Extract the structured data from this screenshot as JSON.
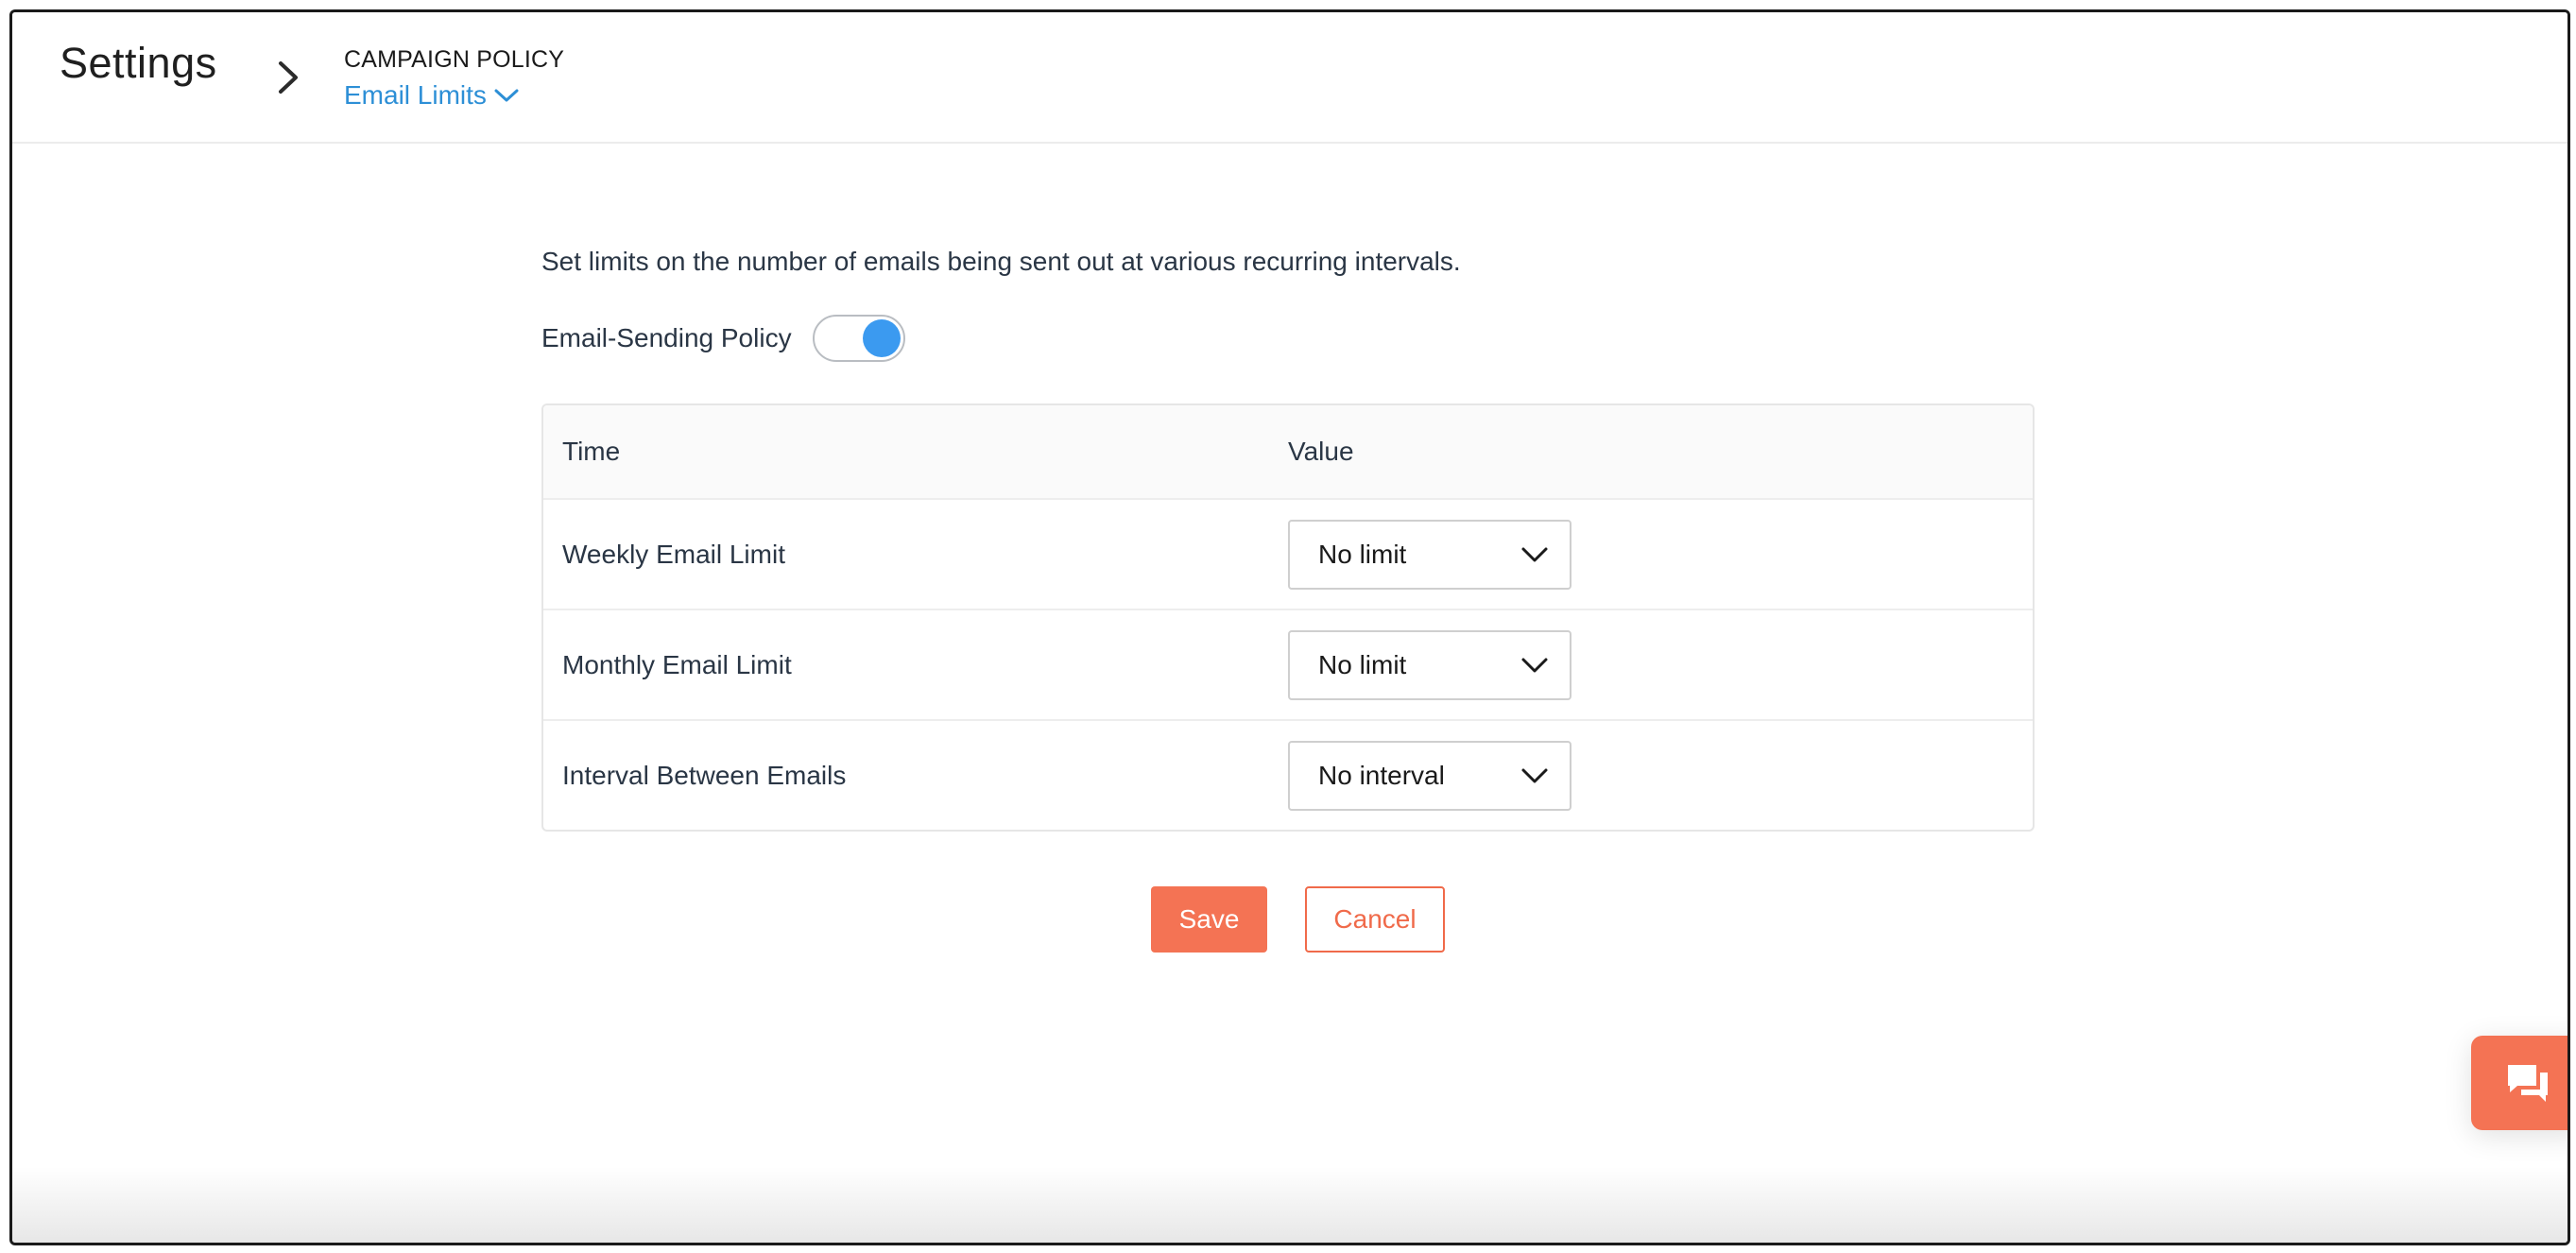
{
  "header": {
    "title": "Settings",
    "breadcrumb_section": "CAMPAIGN POLICY",
    "breadcrumb_current": "Email Limits"
  },
  "main": {
    "description": "Set limits on the number of emails being sent out at various recurring intervals.",
    "policy_label": "Email-Sending Policy",
    "policy_enabled": true,
    "table": {
      "headers": [
        "Time",
        "Value"
      ],
      "rows": [
        {
          "time": "Weekly Email Limit",
          "value": "No limit"
        },
        {
          "time": "Monthly Email Limit",
          "value": "No limit"
        },
        {
          "time": "Interval Between Emails",
          "value": "No interval"
        }
      ]
    },
    "save_label": "Save",
    "cancel_label": "Cancel"
  },
  "icons": {
    "breadcrumb_separator": "chevron-right-icon",
    "dropdown": "chevron-down-icon",
    "chat": "chat-icon"
  },
  "colors": {
    "accent_link": "#2d8fd6",
    "toggle_on": "#3b9af0",
    "primary_button": "#f47354"
  }
}
